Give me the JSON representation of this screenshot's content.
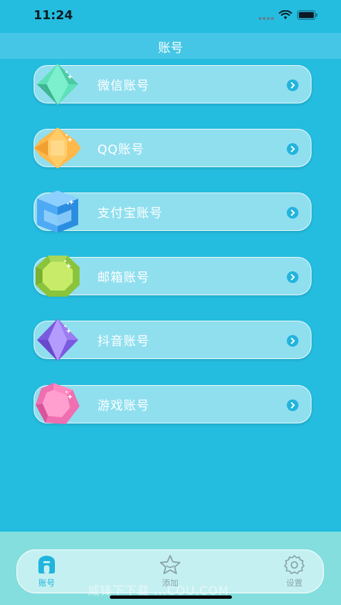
{
  "status_bar": {
    "time": "11:24"
  },
  "header": {
    "title": "账号"
  },
  "accounts": [
    {
      "label": "微信账号",
      "gem": "green-gem-icon",
      "color": "#5ee0b8"
    },
    {
      "label": "QQ账号",
      "gem": "orange-gem-icon",
      "color": "#ffb84a"
    },
    {
      "label": "支付宝账号",
      "gem": "blue-gem-icon",
      "color": "#3a9ff0"
    },
    {
      "label": "邮箱账号",
      "gem": "lime-gem-icon",
      "color": "#a8d85a"
    },
    {
      "label": "抖音账号",
      "gem": "purple-gem-icon",
      "color": "#9b7cf0"
    },
    {
      "label": "游戏账号",
      "gem": "pink-gem-icon",
      "color": "#f06fb0"
    }
  ],
  "tabs": [
    {
      "label": "账号",
      "icon": "home-icon",
      "active": true
    },
    {
      "label": "添加",
      "icon": "star-icon",
      "active": false
    },
    {
      "label": "设置",
      "icon": "gear-icon",
      "active": false
    }
  ],
  "watermark": "威锋下下载 ...COU.COM",
  "colors": {
    "background": "#24bde0",
    "card": "#90dfef",
    "tab_active": "#1fb5dd",
    "tab_inactive": "#8aa5ad"
  }
}
